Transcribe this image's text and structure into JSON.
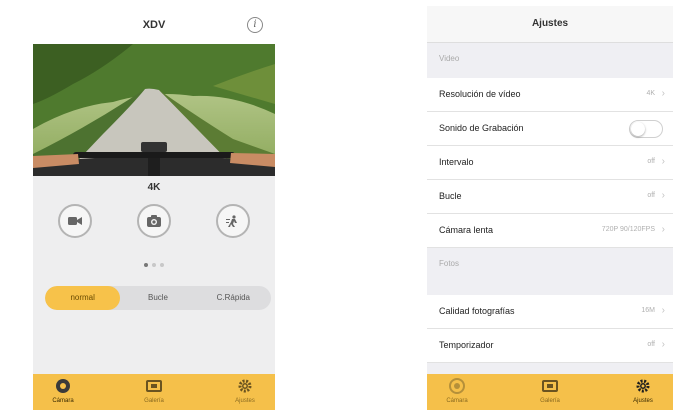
{
  "camera_screen": {
    "title": "XDV",
    "resolution": "4K",
    "page_indicator": {
      "count": 3,
      "active": 0
    },
    "modes": [
      {
        "icon": "video-camera-icon",
        "label": ""
      },
      {
        "icon": "photo-camera-icon",
        "label": ""
      },
      {
        "icon": "timelapse-icon",
        "label": ""
      }
    ],
    "segments": [
      {
        "label": "normal",
        "active": true
      },
      {
        "label": "Bucle",
        "active": false
      },
      {
        "label": "C.Rápida",
        "active": false
      }
    ]
  },
  "settings_screen": {
    "title": "Ajustes",
    "sections": [
      {
        "header": "Video",
        "rows": [
          {
            "label": "Resolución de vídeo",
            "value": "4K"
          },
          {
            "label": "Sonido de Grabación",
            "toggle": false
          },
          {
            "label": "Intervalo",
            "value": "off"
          },
          {
            "label": "Bucle",
            "value": "off"
          },
          {
            "label": "Cámara lenta",
            "value": "720P 90/120FPS"
          }
        ]
      },
      {
        "header": "Fotos",
        "rows": [
          {
            "label": "Calidad fotografías",
            "value": "16M"
          },
          {
            "label": "Temporizador",
            "value": "off"
          }
        ]
      }
    ]
  },
  "tabbar": {
    "items": [
      {
        "label": "Cámara",
        "icon": "camera-lens-icon"
      },
      {
        "label": "Galería",
        "icon": "gallery-icon"
      },
      {
        "label": "Ajustes",
        "icon": "settings-gear-icon"
      }
    ]
  },
  "colors": {
    "accent": "#f5c04a",
    "background": "#eeeeef",
    "value_text": "#b0b0b0"
  }
}
